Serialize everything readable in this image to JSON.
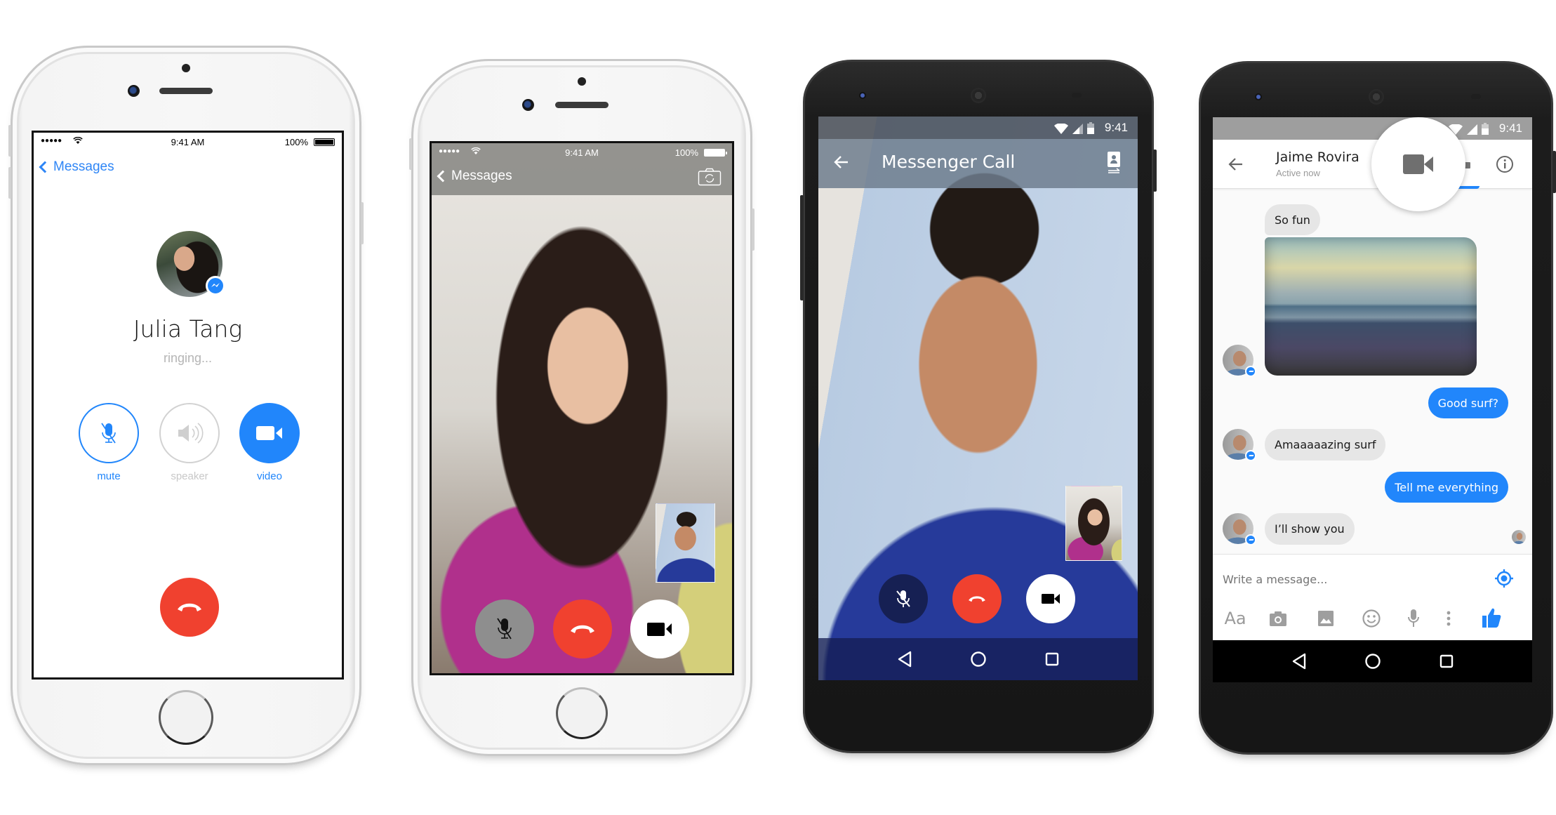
{
  "colors": {
    "messenger_blue": "#2186fb",
    "end_call_red": "#f0412f",
    "ios_link_blue": "#2f86f6",
    "muted_gray": "#c8c8c8"
  },
  "phone1": {
    "status": {
      "signal": "●●●●●",
      "wifi_icon": "wifi-icon",
      "time": "9:41 AM",
      "battery_pct": "100%",
      "battery_level": 1.0
    },
    "nav": {
      "back_label": "Messages"
    },
    "callee": {
      "name": "Julia Tang",
      "status": "ringing..."
    },
    "buttons": [
      {
        "id": "mute",
        "label": "mute",
        "icon": "muted-mic-icon",
        "state": "outlined-blue"
      },
      {
        "id": "speaker",
        "label": "speaker",
        "icon": "speaker-icon",
        "state": "disabled"
      },
      {
        "id": "video",
        "label": "video",
        "icon": "video-camera-icon",
        "state": "filled-blue"
      }
    ],
    "end_call_icon": "hang-up-phone-icon"
  },
  "phone2": {
    "status": {
      "signal": "●●●●●",
      "wifi_icon": "wifi-icon",
      "time": "9:41 AM",
      "battery_pct": "100%",
      "battery_level": 1.0
    },
    "nav": {
      "back_label": "Messages",
      "right_icon": "switch-camera-icon"
    },
    "controls": [
      "muted-mic-icon",
      "hang-up-phone-icon",
      "video-camera-icon"
    ]
  },
  "phone3": {
    "status": {
      "time": "9:41"
    },
    "toolbar": {
      "title": "Messenger Call",
      "back_icon": "arrow-back-icon",
      "right_icon": "switch-camera-icon"
    },
    "controls": [
      "muted-mic-icon",
      "hang-up-phone-icon",
      "video-camera-icon"
    ],
    "nav": [
      "back-triangle-icon",
      "home-circle-icon",
      "recents-square-icon"
    ]
  },
  "phone4": {
    "status": {
      "time": "9:41"
    },
    "header": {
      "name": "Jaime Rovira",
      "presence": "Active now",
      "highlight_icon": "video-camera-icon",
      "info_icon": "info-icon"
    },
    "messages": [
      {
        "from": "them",
        "type": "text",
        "text": "So fun"
      },
      {
        "from": "them",
        "type": "image",
        "alt": "beach photo"
      },
      {
        "from": "me",
        "type": "text",
        "text": "Good surf?"
      },
      {
        "from": "them",
        "type": "text",
        "text": "Amaaaaazing surf"
      },
      {
        "from": "me",
        "type": "text",
        "text": "Tell me everything"
      },
      {
        "from": "them",
        "type": "text",
        "text": "I’ll show you"
      }
    ],
    "composer": {
      "placeholder": "Write a message...",
      "location_icon": "location-target-icon",
      "tools": [
        {
          "icon": "text-size-icon",
          "label": "Aa"
        },
        {
          "icon": "camera-icon"
        },
        {
          "icon": "gallery-icon"
        },
        {
          "icon": "emoji-icon"
        },
        {
          "icon": "microphone-icon"
        },
        {
          "icon": "more-vertical-icon"
        },
        {
          "icon": "thumbs-up-icon"
        }
      ]
    },
    "nav": [
      "back-triangle-icon",
      "home-circle-icon",
      "recents-square-icon"
    ]
  }
}
